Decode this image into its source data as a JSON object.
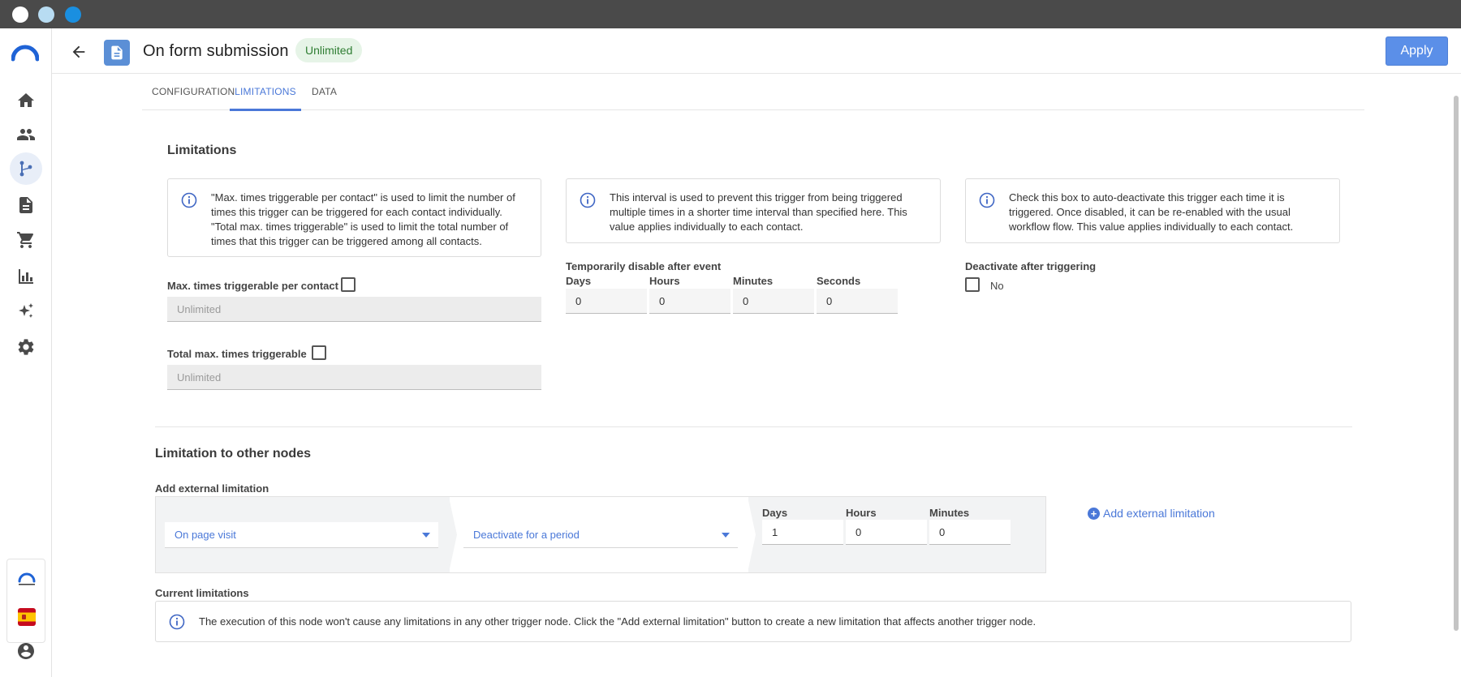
{
  "header": {
    "title": "On form submission",
    "badge": "Unlimited",
    "apply_label": "Apply"
  },
  "sidebar": {
    "items": [
      {
        "icon": "home-icon"
      },
      {
        "icon": "contacts-icon"
      },
      {
        "icon": "workflow-icon",
        "active": true
      },
      {
        "icon": "document-icon"
      },
      {
        "icon": "cart-icon"
      },
      {
        "icon": "bar-chart-icon"
      },
      {
        "icon": "sparkle-icon"
      },
      {
        "icon": "gear-icon"
      }
    ],
    "bottom": [
      "connectif-logo",
      "spain-flag-icon",
      "account-icon"
    ]
  },
  "tabs": [
    {
      "label": "CONFIGURATION"
    },
    {
      "label": "LIMITATIONS",
      "active": true
    },
    {
      "label": "DATA"
    }
  ],
  "limitations": {
    "title": "Limitations",
    "info1": "\"Max. times triggerable per contact\" is used to limit the number of times this trigger can be triggered for each contact individually. \"Total max. times triggerable\" is used to limit the total number of times that this trigger can be triggered among all contacts.",
    "info2": "This interval is used to prevent this trigger from being triggered multiple times in a shorter time interval than specified here. This value applies individually to each contact.",
    "info3": "Check this box to auto-deactivate this trigger each time it is triggered. Once disabled, it can be re-enabled with the usual workflow flow. This value applies individually to each contact.",
    "max_per_contact_label": "Max. times triggerable per contact",
    "max_per_contact_value": "Unlimited",
    "total_max_label": "Total max. times triggerable",
    "total_max_value": "Unlimited",
    "temp_disable_label": "Temporarily disable after event",
    "days_label": "Days",
    "hours_label": "Hours",
    "minutes_label": "Minutes",
    "seconds_label": "Seconds",
    "days_value": "0",
    "hours_value": "0",
    "minutes_value": "0",
    "seconds_value": "0",
    "deactivate_label": "Deactivate after triggering",
    "deactivate_value": "No"
  },
  "other_nodes": {
    "title": "Limitation to other nodes",
    "add_label": "Add external limitation",
    "node_select": "On page visit",
    "action_select": "Deactivate for a period",
    "days_label": "Days",
    "hours_label": "Hours",
    "minutes_label": "Minutes",
    "days_value": "1",
    "hours_value": "0",
    "minutes_value": "0",
    "add_button": "Add external limitation",
    "current_label": "Current limitations",
    "current_info": "The execution of this node won't cause any limitations in any other trigger node. Click the \"Add external limitation\" button to create a new limitation that affects another trigger node."
  },
  "colors": {
    "accent": "#4a78d8",
    "apply": "#5b8fe8",
    "badge_bg": "#e6f4e7",
    "badge_text": "#2e7d32",
    "titlebar": "#4a4a4a"
  }
}
